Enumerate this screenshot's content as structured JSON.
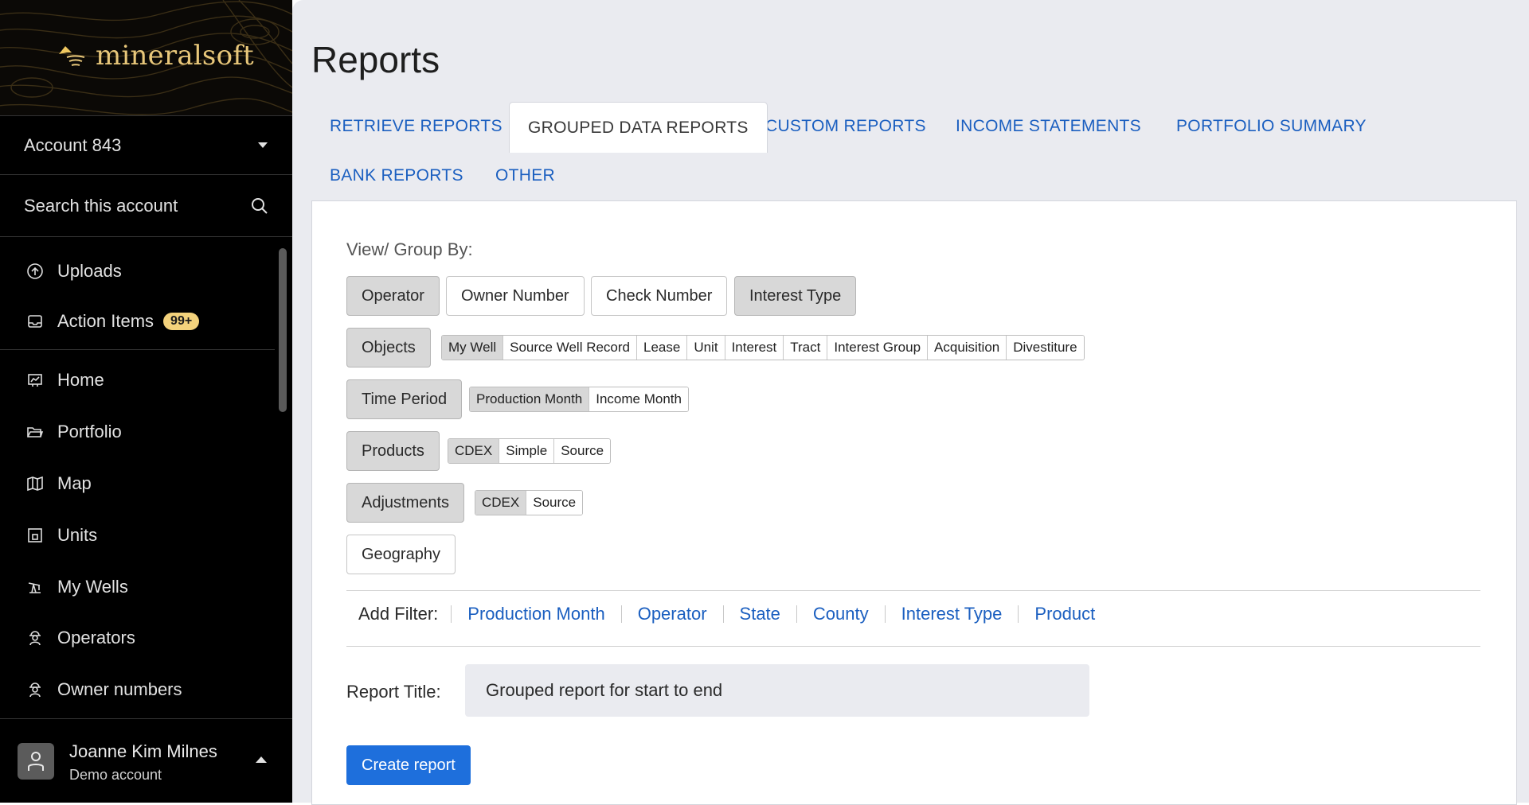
{
  "brand": {
    "name": "mineralsoft",
    "accent": "#e8c77a"
  },
  "sidebar": {
    "account": {
      "label": "Account 843",
      "icon": "caret-down-icon"
    },
    "search": {
      "placeholder": "Search this account",
      "icon": "search-icon"
    },
    "items": [
      {
        "label": "Uploads",
        "icon": "upload-cloud-icon"
      },
      {
        "label": "Action Items",
        "icon": "inbox-icon",
        "badge": "99+"
      },
      {
        "label": "Home",
        "icon": "dashboard-icon"
      },
      {
        "label": "Portfolio",
        "icon": "folder-open-icon"
      },
      {
        "label": "Map",
        "icon": "map-icon"
      },
      {
        "label": "Units",
        "icon": "units-icon"
      },
      {
        "label": "My Wells",
        "icon": "pumpjack-icon"
      },
      {
        "label": "Operators",
        "icon": "worker-icon"
      },
      {
        "label": "Owner numbers",
        "icon": "worker-icon"
      }
    ],
    "user": {
      "name": "Joanne Kim Milnes",
      "subtitle": "Demo account",
      "icon": "user-icon"
    }
  },
  "main": {
    "title": "Reports",
    "tabs": [
      {
        "label": "RETRIEVE REPORTS",
        "active": false
      },
      {
        "label": "GROUPED DATA REPORTS",
        "active": true
      },
      {
        "label": "CUSTOM REPORTS",
        "active": false
      },
      {
        "label": "INCOME STATEMENTS",
        "active": false
      },
      {
        "label": "PORTFOLIO SUMMARY",
        "active": false
      },
      {
        "label": "BANK REPORTS",
        "active": false
      },
      {
        "label": "OTHER",
        "active": false
      }
    ],
    "group_by_label": "View/ Group By:",
    "group_buttons": [
      {
        "label": "Operator",
        "selected": true
      },
      {
        "label": "Owner Number",
        "selected": false
      },
      {
        "label": "Check Number",
        "selected": false
      },
      {
        "label": "Interest Type",
        "selected": true
      }
    ],
    "rows": {
      "objects": {
        "label": "Objects",
        "selected": true,
        "options": [
          "My Well",
          "Source Well Record",
          "Lease",
          "Unit",
          "Interest",
          "Tract",
          "Interest Group",
          "Acquisition",
          "Divestiture"
        ],
        "active": "My Well"
      },
      "time_period": {
        "label": "Time Period",
        "selected": true,
        "options": [
          "Production Month",
          "Income Month"
        ],
        "active": "Production Month"
      },
      "products": {
        "label": "Products",
        "selected": true,
        "options": [
          "CDEX",
          "Simple",
          "Source"
        ],
        "active": "CDEX"
      },
      "adjustments": {
        "label": "Adjustments",
        "selected": true,
        "options": [
          "CDEX",
          "Source"
        ],
        "active": "CDEX"
      },
      "geography": {
        "label": "Geography",
        "selected": false
      }
    },
    "filters": {
      "label": "Add Filter:",
      "links": [
        "Production Month",
        "Operator",
        "State",
        "County",
        "Interest Type",
        "Product"
      ]
    },
    "report_title": {
      "label": "Report Title:",
      "value": "Grouped report for start to end"
    },
    "create_label": "Create report",
    "colors": {
      "link": "#1b5fc0",
      "primary_button": "#1e6fdc",
      "badge": "#f3d27c"
    }
  }
}
